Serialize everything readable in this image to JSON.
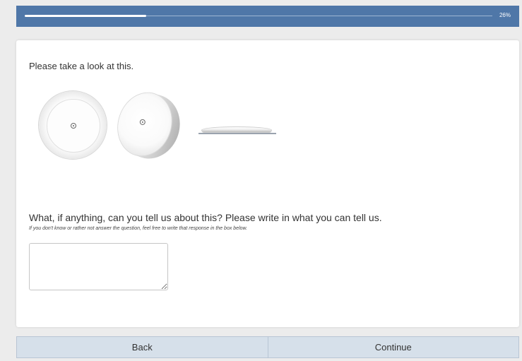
{
  "progress": {
    "percent_label": "26%",
    "fraction": 0.26
  },
  "content": {
    "intro": "Please take a look at this.",
    "question": "What, if anything, can you tell us about this? Please write in what you can tell us.",
    "instruction": "If you don't know or rather not answer the question, feel free to write that response in the box below.",
    "answer_value": ""
  },
  "nav": {
    "back_label": "Back",
    "continue_label": "Continue"
  },
  "colors": {
    "header": "#4f77a8",
    "nav_bg": "#d6e0ea"
  }
}
